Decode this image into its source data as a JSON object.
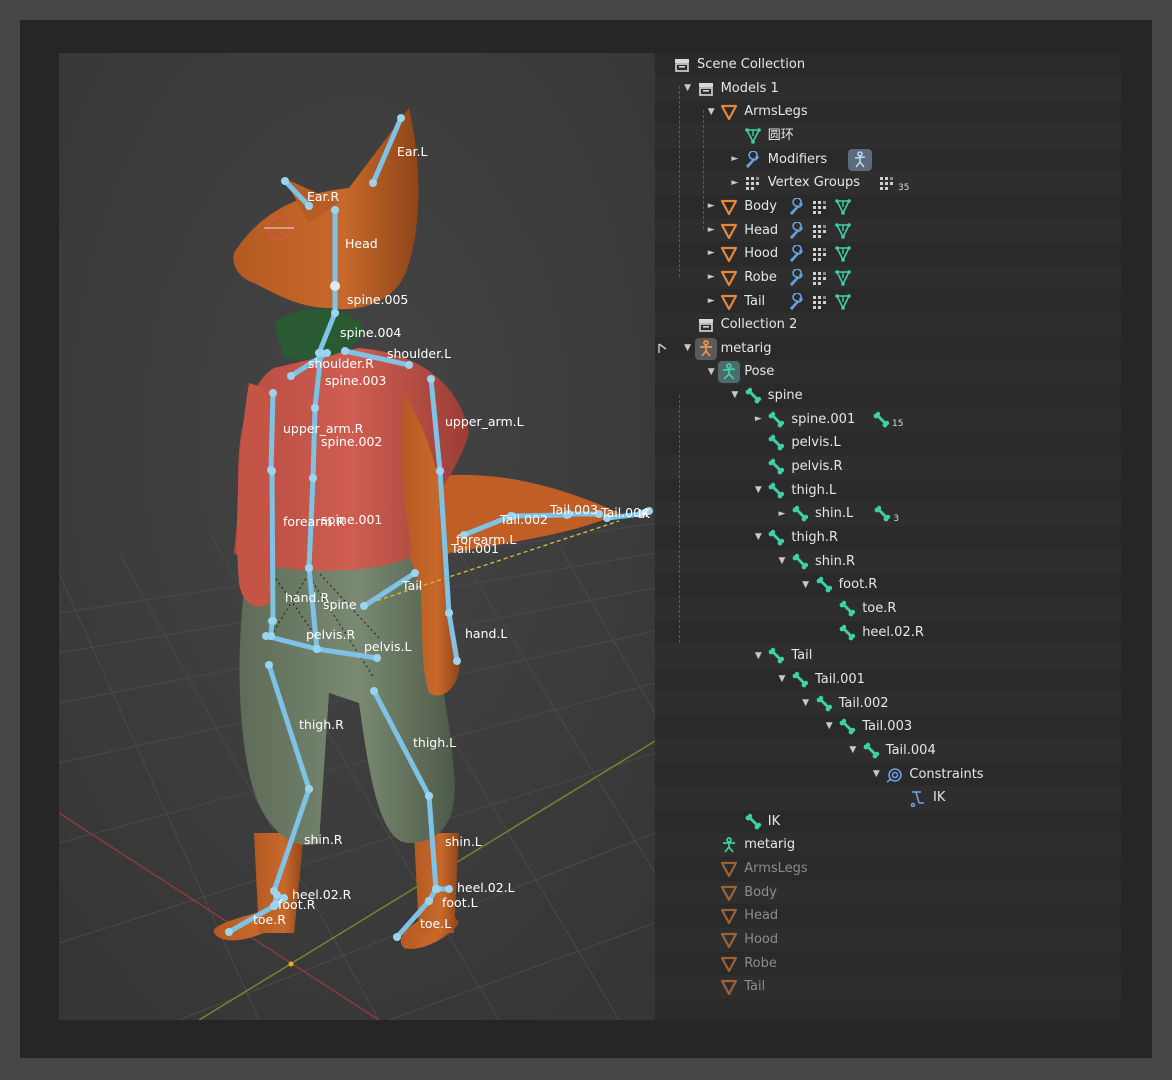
{
  "viewport": {
    "bones": [
      "Ear.L",
      "Ear.R",
      "Head",
      "spine.005",
      "spine.004",
      "shoulder.L",
      "shoulder.R",
      "spine.003",
      "upper_arm.R",
      "spine.002",
      "upper_arm.L",
      "forearm.R",
      "spine.001",
      "Tail.002",
      "Tail.003",
      "Tail.004",
      "IK",
      "forearm.L",
      "Tail.001",
      "Tail",
      "hand.R",
      "spine",
      "pelvis.R",
      "pelvis.L",
      "hand.L",
      "thigh.R",
      "thigh.L",
      "shin.R",
      "shin.L",
      "heel.02.R",
      "foot.R",
      "toe.R",
      "heel.02.L",
      "foot.L",
      "toe.L"
    ]
  },
  "colors": {
    "bone": "#7ec3e6",
    "mesh": "#3e8fd0",
    "object": "#e8873a",
    "data": "#3ed0a8",
    "modifier": "#6a9fe0",
    "selected_bone": "#dfe9ef"
  },
  "outliner": {
    "rows": [
      {
        "label": "Scene Collection",
        "icon": "collection-white-icon",
        "indent": 0,
        "toggle": ""
      },
      {
        "label": "Models 1",
        "icon": "collection-white-icon",
        "indent": 1,
        "toggle": "▼"
      },
      {
        "label": "ArmsLegs",
        "icon": "mesh-object-icon",
        "indent": 2,
        "toggle": "▼"
      },
      {
        "label": "圆环",
        "icon": "mesh-data-icon",
        "indent": 3,
        "toggle": ""
      },
      {
        "label": "Modifiers",
        "icon": "wrench-icon",
        "indent": 3,
        "toggle": "►",
        "extras": [
          "armature-modifier-icon"
        ]
      },
      {
        "label": "Vertex Groups",
        "icon": "vertex-groups-icon",
        "indent": 3,
        "toggle": "►",
        "extras": [
          "vertex-groups-icon"
        ],
        "count": "35"
      },
      {
        "label": "Body",
        "icon": "mesh-object-icon",
        "indent": 2,
        "toggle": "►",
        "extras": [
          "wrench-icon",
          "vertex-groups-icon",
          "mesh-data-icon"
        ]
      },
      {
        "label": "Head",
        "icon": "mesh-object-icon",
        "indent": 2,
        "toggle": "►",
        "extras": [
          "wrench-icon",
          "vertex-groups-icon",
          "mesh-data-icon"
        ]
      },
      {
        "label": "Hood",
        "icon": "mesh-object-icon",
        "indent": 2,
        "toggle": "►",
        "extras": [
          "wrench-icon",
          "vertex-groups-icon",
          "mesh-data-icon"
        ]
      },
      {
        "label": "Robe",
        "icon": "mesh-object-icon",
        "indent": 2,
        "toggle": "►",
        "extras": [
          "wrench-icon",
          "vertex-groups-icon",
          "mesh-data-icon"
        ]
      },
      {
        "label": "Tail",
        "icon": "mesh-object-icon",
        "indent": 2,
        "toggle": "►",
        "extras": [
          "wrench-icon",
          "vertex-groups-icon",
          "mesh-data-icon"
        ]
      },
      {
        "label": "Collection 2",
        "icon": "collection-white-icon",
        "indent": 1,
        "toggle": ""
      },
      {
        "label": "metarig",
        "icon": "armature-object-icon",
        "indent": 1,
        "toggle": "▼",
        "pick": true
      },
      {
        "label": "Pose",
        "icon": "pose-icon",
        "indent": 2,
        "toggle": "▼"
      },
      {
        "label": "spine",
        "icon": "bone-icon",
        "indent": 3,
        "toggle": "▼"
      },
      {
        "label": "spine.001",
        "icon": "bone-icon",
        "indent": 4,
        "toggle": "►",
        "extras": [
          "bone-icon"
        ],
        "count": "15"
      },
      {
        "label": "pelvis.L",
        "icon": "bone-icon",
        "indent": 4,
        "toggle": ""
      },
      {
        "label": "pelvis.R",
        "icon": "bone-icon",
        "indent": 4,
        "toggle": ""
      },
      {
        "label": "thigh.L",
        "icon": "bone-icon",
        "indent": 4,
        "toggle": "▼"
      },
      {
        "label": "shin.L",
        "icon": "bone-icon",
        "indent": 5,
        "toggle": "►",
        "extras": [
          "bone-icon"
        ],
        "count": "3"
      },
      {
        "label": "thigh.R",
        "icon": "bone-icon",
        "indent": 4,
        "toggle": "▼"
      },
      {
        "label": "shin.R",
        "icon": "bone-icon",
        "indent": 5,
        "toggle": "▼"
      },
      {
        "label": "foot.R",
        "icon": "bone-icon",
        "indent": 6,
        "toggle": "▼"
      },
      {
        "label": "toe.R",
        "icon": "bone-icon",
        "indent": 7,
        "toggle": ""
      },
      {
        "label": "heel.02.R",
        "icon": "bone-icon",
        "indent": 7,
        "toggle": ""
      },
      {
        "label": "Tail",
        "icon": "bone-icon",
        "indent": 4,
        "toggle": "▼"
      },
      {
        "label": "Tail.001",
        "icon": "bone-icon",
        "indent": 5,
        "toggle": "▼"
      },
      {
        "label": "Tail.002",
        "icon": "bone-icon",
        "indent": 6,
        "toggle": "▼"
      },
      {
        "label": "Tail.003",
        "icon": "bone-icon",
        "indent": 7,
        "toggle": "▼"
      },
      {
        "label": "Tail.004",
        "icon": "bone-icon",
        "indent": 8,
        "toggle": "▼"
      },
      {
        "label": "Constraints",
        "icon": "constraint-icon",
        "indent": 9,
        "toggle": "▼"
      },
      {
        "label": "IK",
        "icon": "ik-constraint-icon",
        "indent": 10,
        "toggle": ""
      },
      {
        "label": "IK",
        "icon": "bone-icon",
        "indent": 3,
        "toggle": ""
      },
      {
        "label": "metarig",
        "icon": "armature-data-icon",
        "indent": 2,
        "toggle": ""
      },
      {
        "label": "ArmsLegs",
        "icon": "mesh-object-icon",
        "indent": 2,
        "toggle": "",
        "dim": true
      },
      {
        "label": "Body",
        "icon": "mesh-object-icon",
        "indent": 2,
        "toggle": "",
        "dim": true
      },
      {
        "label": "Head",
        "icon": "mesh-object-icon",
        "indent": 2,
        "toggle": "",
        "dim": true
      },
      {
        "label": "Hood",
        "icon": "mesh-object-icon",
        "indent": 2,
        "toggle": "",
        "dim": true
      },
      {
        "label": "Robe",
        "icon": "mesh-object-icon",
        "indent": 2,
        "toggle": "",
        "dim": true
      },
      {
        "label": "Tail",
        "icon": "mesh-object-icon",
        "indent": 2,
        "toggle": "",
        "dim": true
      }
    ]
  }
}
